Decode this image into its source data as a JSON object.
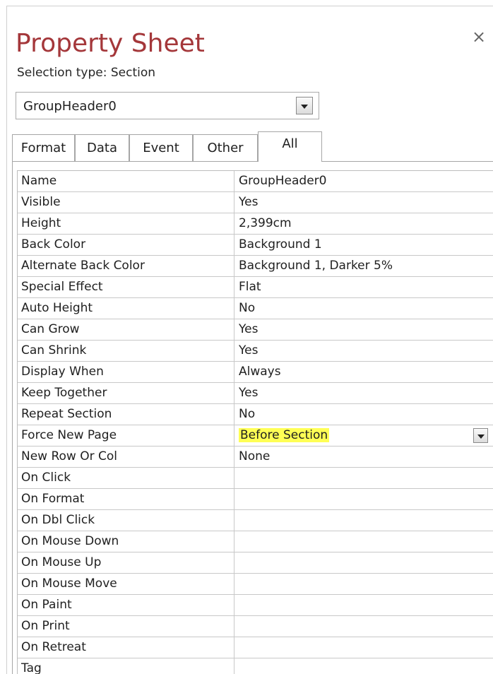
{
  "header": {
    "title": "Property Sheet",
    "close_symbol": "×",
    "selection_type": "Selection type:  Section"
  },
  "selector": {
    "value": "GroupHeader0",
    "button_icon": "chevron-down-icon"
  },
  "tabs": [
    {
      "label": "Format",
      "active": false
    },
    {
      "label": "Data",
      "active": false
    },
    {
      "label": "Event",
      "active": false
    },
    {
      "label": "Other",
      "active": false
    },
    {
      "label": "All",
      "active": true
    }
  ],
  "properties": [
    {
      "name": "Name",
      "value": "GroupHeader0"
    },
    {
      "name": "Visible",
      "value": "Yes"
    },
    {
      "name": "Height",
      "value": "2,399cm"
    },
    {
      "name": "Back Color",
      "value": "Background 1"
    },
    {
      "name": "Alternate Back Color",
      "value": "Background 1, Darker 5%"
    },
    {
      "name": "Special Effect",
      "value": "Flat"
    },
    {
      "name": "Auto Height",
      "value": "No"
    },
    {
      "name": "Can Grow",
      "value": "Yes"
    },
    {
      "name": "Can Shrink",
      "value": "Yes"
    },
    {
      "name": "Display When",
      "value": "Always"
    },
    {
      "name": "Keep Together",
      "value": "Yes"
    },
    {
      "name": "Repeat Section",
      "value": "No"
    },
    {
      "name": "Force New Page",
      "value": "Before Section",
      "highlighted": true,
      "has_dropdown": true
    },
    {
      "name": "New Row Or Col",
      "value": "None"
    },
    {
      "name": "On Click",
      "value": ""
    },
    {
      "name": "On Format",
      "value": ""
    },
    {
      "name": "On Dbl Click",
      "value": ""
    },
    {
      "name": "On Mouse Down",
      "value": ""
    },
    {
      "name": "On Mouse Up",
      "value": ""
    },
    {
      "name": "On Mouse Move",
      "value": ""
    },
    {
      "name": "On Paint",
      "value": ""
    },
    {
      "name": "On Print",
      "value": ""
    },
    {
      "name": "On Retreat",
      "value": ""
    },
    {
      "name": "Tag",
      "value": ""
    }
  ],
  "colors": {
    "title": "#a4373a",
    "highlight": "#ffff55"
  }
}
